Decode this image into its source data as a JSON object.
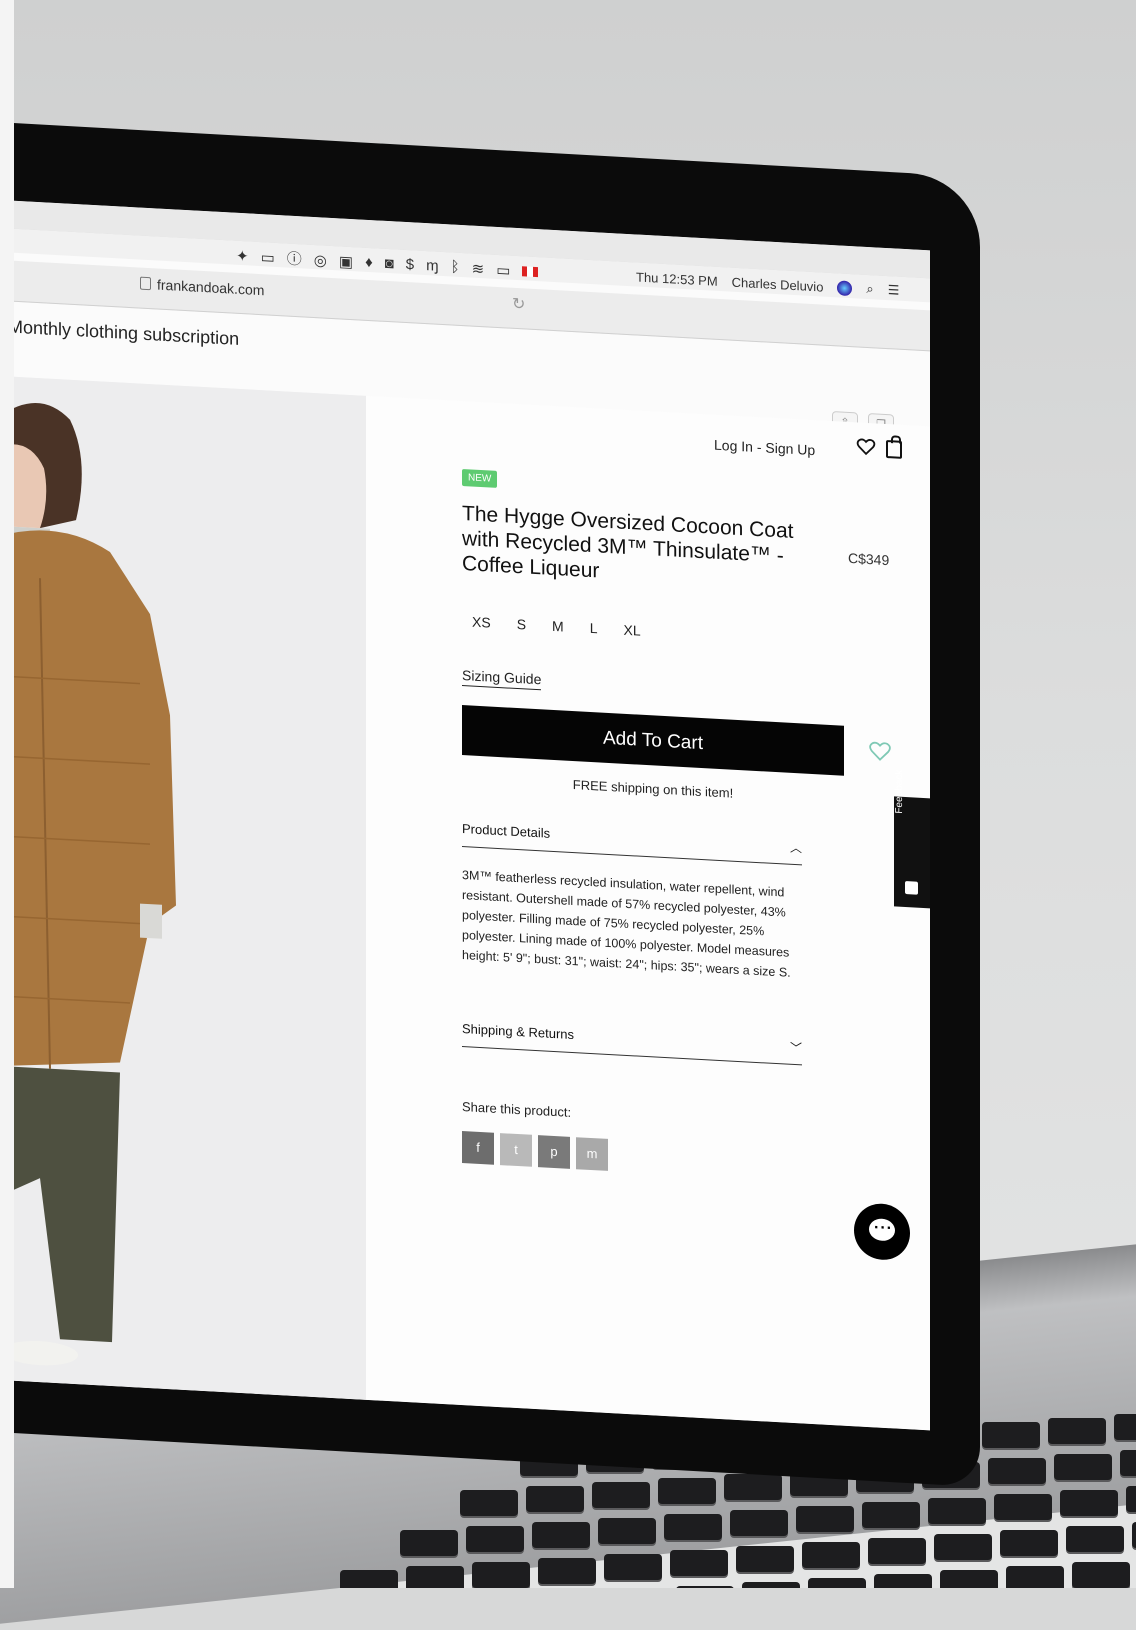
{
  "menubar": {
    "clock": "Thu 12:53 PM",
    "user": "Charles Deluvio"
  },
  "browser": {
    "url": "frankandoak.com"
  },
  "site": {
    "header_text": "Monthly clothing subscription",
    "auth_link": "Log In - Sign Up"
  },
  "product": {
    "badge": "NEW",
    "title": "The Hygge Oversized Cocoon Coat with Recycled 3M™ Thinsulate™ - Coffee Liqueur",
    "price": "C$349",
    "sizes": [
      "XS",
      "S",
      "M",
      "L",
      "XL"
    ],
    "sizing_guide": "Sizing Guide",
    "add_to_cart": "Add To Cart",
    "shipping_note": "FREE shipping on this item!",
    "details_heading": "Product Details",
    "details_text": "3M™ featherless recycled insulation, water repellent, wind resistant. Outershell made of 57% recycled polyester, 43% polyester. Filling made of 75% recycled polyester, 25% polyester. Lining made of 100% polyester. Model measures height: 5' 9\"; bust: 31\"; waist: 24\"; hips: 35\"; wears a size S.",
    "shipping_heading": "Shipping & Returns",
    "share_label": "Share this product:",
    "share_icons": [
      "f",
      "t",
      "p",
      "m"
    ]
  },
  "feedback": {
    "label": "Feedback"
  },
  "colors": {
    "accent_new": "#5ecb71",
    "button": "#050505",
    "coat": "#a9773f",
    "wish": "#7fc9b5"
  }
}
